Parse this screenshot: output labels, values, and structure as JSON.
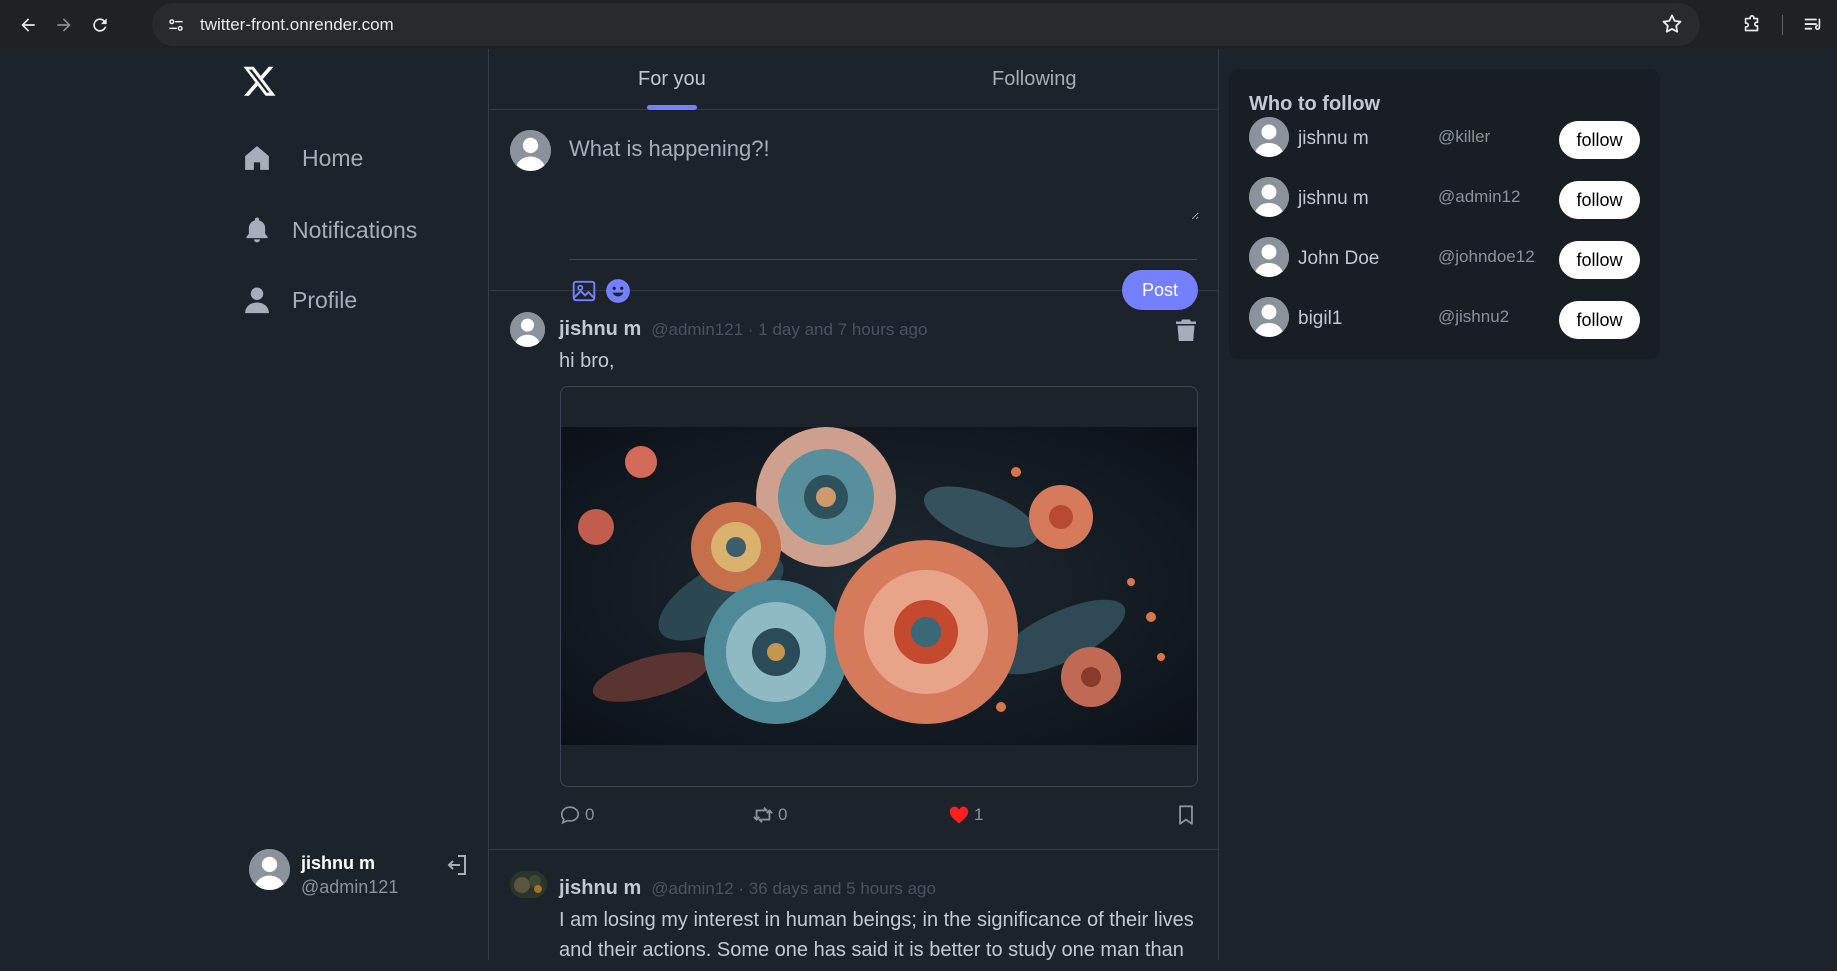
{
  "browser": {
    "url": "twitter-front.onrender.com"
  },
  "sidebar": {
    "items": [
      {
        "label": "Home",
        "icon": "home-icon"
      },
      {
        "label": "Notifications",
        "icon": "bell-icon"
      },
      {
        "label": "Profile",
        "icon": "user-icon"
      }
    ],
    "current_user": {
      "name": "jishnu m",
      "handle": "@admin121"
    }
  },
  "feed": {
    "tabs": [
      {
        "label": "For you",
        "active": true
      },
      {
        "label": "Following",
        "active": false
      }
    ],
    "compose": {
      "placeholder": "What is happening?!",
      "post_label": "Post"
    },
    "posts": [
      {
        "author": "jishnu m",
        "meta": "@admin121 · 1 day and 7 hours ago",
        "text": "hi bro,",
        "comments": "0",
        "retweets": "0",
        "likes": "1"
      },
      {
        "author": "jishnu m",
        "meta": "@admin12 · 36 days and 5 hours ago",
        "text": "I am losing my interest in human beings; in the significance of their lives and their actions. Some one has said it is better to study one man than"
      }
    ]
  },
  "who_to_follow": {
    "title": "Who to follow",
    "follow_label": "follow",
    "users": [
      {
        "name": "jishnu m",
        "handle": "@killer"
      },
      {
        "name": "jishnu m",
        "handle": "@admin12"
      },
      {
        "name": "John Doe",
        "handle": "@johndoe12"
      },
      {
        "name": "bigil1",
        "handle": "@jishnu2"
      }
    ]
  },
  "colors": {
    "accent": "#7480ff",
    "background": "#1d232a",
    "card": "#191e24",
    "like": "#ff1f1f"
  }
}
